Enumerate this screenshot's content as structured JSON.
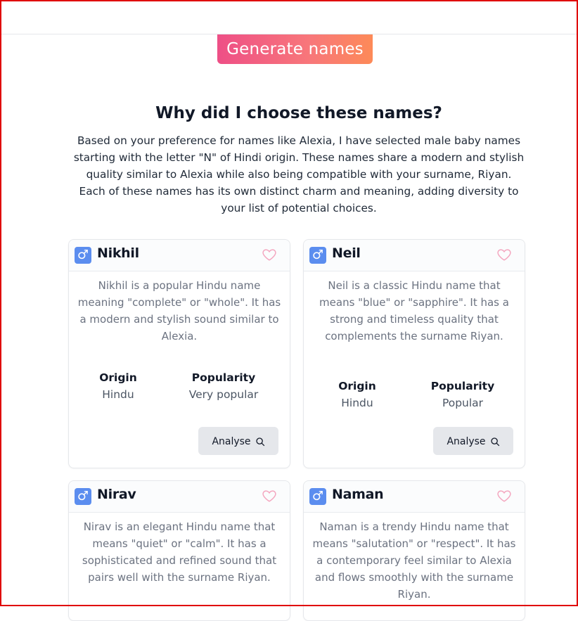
{
  "header": {
    "generate_button": "Generate names"
  },
  "explanation": {
    "title": "Why did I choose these names?",
    "text": "Based on your preference for names like Alexia, I have selected male baby names starting with the letter \"N\" of Hindi origin. These names share a modern and stylish quality similar to Alexia while also being compatible with your surname, Riyan. Each of these names has its own distinct charm and meaning, adding diversity to your list of potential choices."
  },
  "labels": {
    "origin": "Origin",
    "popularity": "Popularity",
    "analyse": "Analyse"
  },
  "icons": {
    "gender": "male-symbol-icon",
    "favorite": "heart-outline-icon",
    "analyse": "search-icon"
  },
  "colors": {
    "gradient_start": "#ee4f86",
    "gradient_end": "#fd8a58",
    "gender_icon_bg": "#5b8def",
    "heart": "#f4a6bf"
  },
  "names": [
    {
      "name": "Nikhil",
      "description": "Nikhil is a popular Hindu name meaning \"complete\" or \"whole\". It has a modern and stylish sound similar to Alexia.",
      "origin": "Hindu",
      "popularity": "Very popular"
    },
    {
      "name": "Neil",
      "description": "Neil is a classic Hindu name that means \"blue\" or \"sapphire\". It has a strong and timeless quality that complements the surname Riyan.",
      "origin": "Hindu",
      "popularity": "Popular"
    },
    {
      "name": "Nirav",
      "description": "Nirav is an elegant Hindu name that means \"quiet\" or \"calm\". It has a sophisticated and refined sound that pairs well with the surname Riyan."
    },
    {
      "name": "Naman",
      "description": "Naman is a trendy Hindu name that means \"salutation\" or \"respect\". It has a contemporary feel similar to Alexia and flows smoothly with the surname Riyan."
    }
  ]
}
